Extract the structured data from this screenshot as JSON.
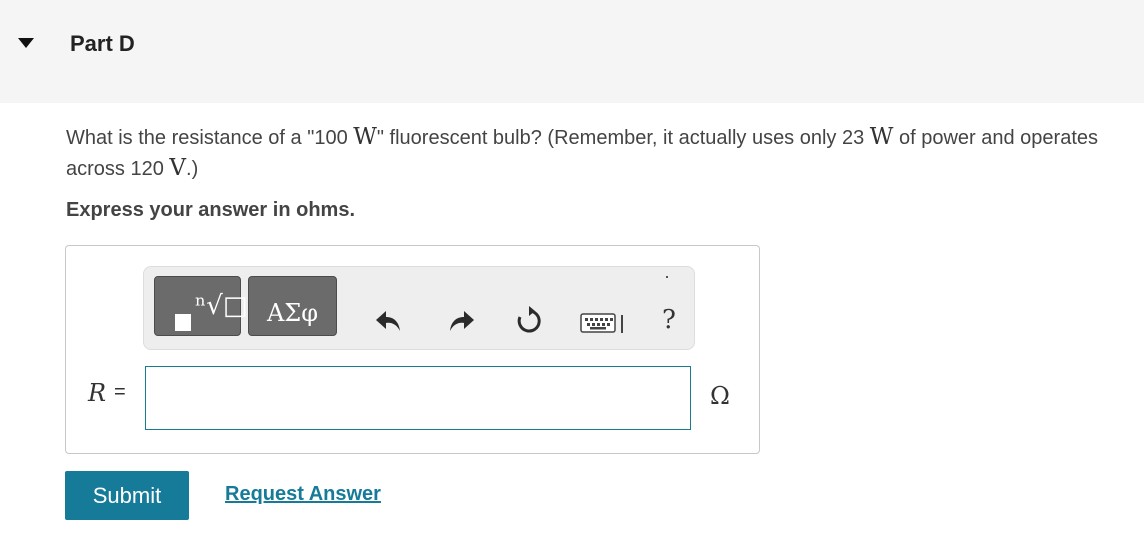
{
  "header": {
    "part_title": "Part D"
  },
  "question": {
    "text_1": "What is the resistance of a \"100 ",
    "unit_w_1": "W",
    "text_2": "\" fluorescent bulb? (Remember, it actually uses only 23 ",
    "unit_w_2": "W",
    "text_3": " of power and operates across 120 ",
    "unit_v": "V",
    "text_4": ".)"
  },
  "instruction": "Express your answer in ohms.",
  "toolbar": {
    "templates_glyph": "ⁿ√□",
    "symbols_label": "ΑΣφ",
    "help_label": "?",
    "icons": [
      "templates-icon",
      "symbols-icon",
      "undo-icon",
      "redo-icon",
      "reset-icon",
      "keyboard-icon",
      "help-icon"
    ]
  },
  "answer": {
    "variable": "R",
    "equals": "=",
    "value": "",
    "unit": "Ω"
  },
  "actions": {
    "submit_label": "Submit",
    "request_answer_label": "Request Answer"
  },
  "colors": {
    "header_bg": "#f5f5f5",
    "accent": "#167a99",
    "toolbar_button": "#6b6b6b",
    "input_border": "#1a7c8f"
  }
}
